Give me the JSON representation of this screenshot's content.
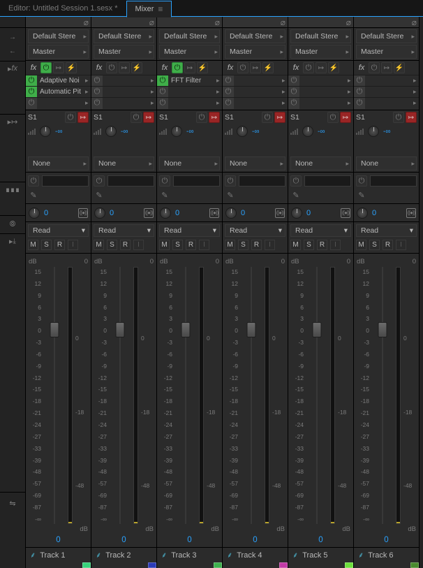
{
  "tabs": {
    "editor_label": "Editor: Untitled Session 1.sesx *",
    "mixer_label": "Mixer"
  },
  "routing_presets": "Default Stere",
  "output_bus": "Master",
  "fx_header": "fx",
  "send": {
    "name": "S1",
    "level": "-∞",
    "bus_none": "None"
  },
  "pan_value": "0",
  "automation_mode": "Read",
  "msr": [
    "M",
    "S",
    "R",
    "I"
  ],
  "scale_left": [
    "dB",
    "15",
    "12",
    "9",
    "6",
    "3",
    "0",
    "-3",
    "-6",
    "-9",
    "-12",
    "-15",
    "-18",
    "-21",
    "-24",
    "-27",
    "-33",
    "-39",
    "-48",
    "-57",
    "-69",
    "-87",
    "-∞"
  ],
  "scale_right": [
    "",
    "",
    "",
    "",
    "",
    "",
    "0",
    "",
    "",
    "",
    "",
    "",
    "-18",
    "",
    "",
    "",
    "",
    "",
    "-48",
    "",
    "",
    "",
    "dB"
  ],
  "fader_value": "0",
  "tracks": [
    {
      "name": "Track 1",
      "effects": [
        "Adaptive Noi",
        "Automatic Pit"
      ],
      "color": "#37d27b"
    },
    {
      "name": "Track 2",
      "effects": [],
      "color": "#2c3bb8"
    },
    {
      "name": "Track 3",
      "effects": [
        "FFT Filter"
      ],
      "color": "#3fb24f"
    },
    {
      "name": "Track 4",
      "effects": [],
      "color": "#c23aa6"
    },
    {
      "name": "Track 5",
      "effects": [],
      "color": "#6ddf3c"
    },
    {
      "name": "Track 6",
      "effects": [],
      "color": "#4a8a2e"
    }
  ]
}
